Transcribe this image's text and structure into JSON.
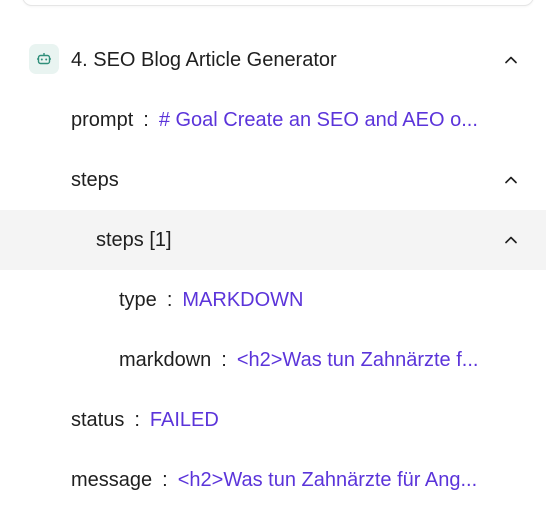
{
  "header": {
    "title": "4. SEO Blog Article Generator",
    "icon": "robot-icon",
    "icon_color": "#2f8f7a",
    "icon_bg": "#e9f4f1"
  },
  "fields": {
    "prompt": {
      "label": "prompt",
      "separator": ":",
      "value": "# Goal Create an SEO and AEO o..."
    },
    "steps": {
      "label": "steps"
    },
    "steps_item": {
      "label": "steps [1]"
    },
    "type": {
      "label": "type",
      "separator": ":",
      "value": "MARKDOWN"
    },
    "markdown": {
      "label": "markdown",
      "separator": ":",
      "value": "<h2>Was tun Zahnärzte f..."
    },
    "status": {
      "label": "status",
      "separator": ":",
      "value": "FAILED"
    },
    "message": {
      "label": "message",
      "separator": ":",
      "value": "<h2>Was tun Zahnärzte für Ang..."
    }
  },
  "colors": {
    "value_text": "#5b34da",
    "label_text": "#1f1f1f",
    "highlight_row": "#f4f4f4"
  }
}
